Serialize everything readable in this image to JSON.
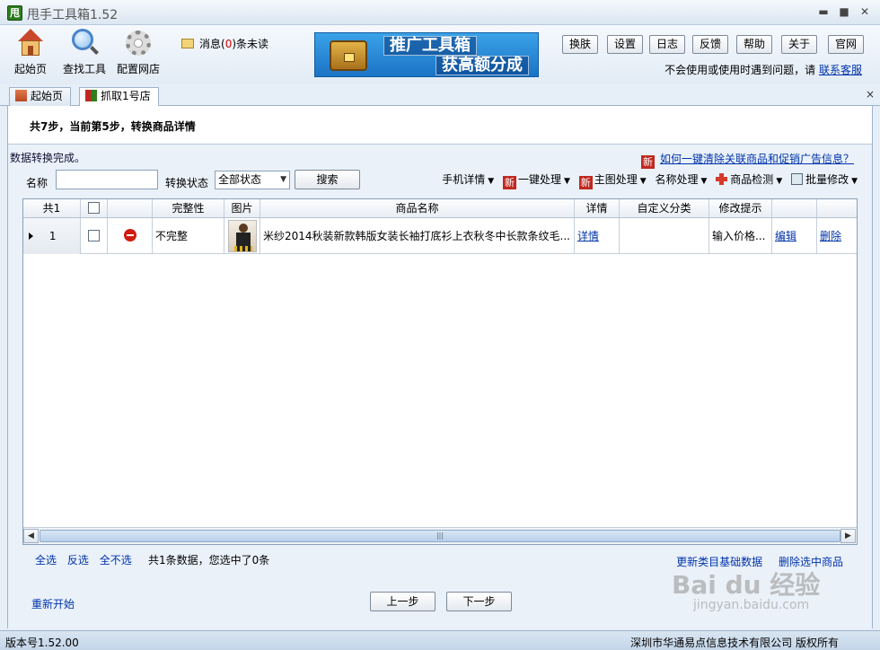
{
  "window": {
    "app_icon_text": "甩",
    "title": "甩手工具箱1.52",
    "minimize": "▬",
    "maximize": "■",
    "close": "✕"
  },
  "toolbar": {
    "tools": [
      {
        "label": "起始页",
        "icon": "house-icon"
      },
      {
        "label": "查找工具",
        "icon": "search-icon"
      },
      {
        "label": "配置网店",
        "icon": "gear-icon"
      }
    ],
    "message": {
      "prefix": "消息(",
      "count": "0",
      "suffix": ")条未读"
    },
    "banner": {
      "line1": "推广工具箱",
      "line2": "获高额分成"
    },
    "buttons": [
      "换肤",
      "设置",
      "日志",
      "反馈",
      "帮助",
      "关于",
      "官网"
    ],
    "help_text": "不会使用或使用时遇到问题，请",
    "help_link": "联系客服"
  },
  "tabs": [
    {
      "label": "起始页",
      "icon": "house-icon",
      "active": false
    },
    {
      "label": "抓取1号店",
      "icon": "store-icon",
      "active": true
    }
  ],
  "tab_close": "×",
  "step_text": "共7步，当前第5步，转换商品详情",
  "status_message": "数据转换完成。",
  "clear_link": {
    "badge": "新",
    "text": "如何一键清除关联商品和促销广告信息？"
  },
  "filter": {
    "name_label": "名称",
    "name_value": "",
    "status_label": "转换状态",
    "status_selected": "全部状态",
    "search_button": "搜索"
  },
  "actions": [
    {
      "label": "手机详情",
      "badge": ""
    },
    {
      "label": "一键处理",
      "badge": "新"
    },
    {
      "label": "主图处理",
      "badge": "新"
    },
    {
      "label": "名称处理",
      "badge": ""
    },
    {
      "label": "商品检测",
      "badge": ""
    },
    {
      "label": "批量修改",
      "badge": ""
    }
  ],
  "grid": {
    "count_header": "共1",
    "columns": [
      "完整性",
      "图片",
      "商品名称",
      "详情",
      "自定义分类",
      "修改提示"
    ],
    "rows": [
      {
        "index": "1",
        "completeness": "不完整",
        "name": "米纱2014秋装新款韩版女装长袖打底衫上衣秋冬中长款条纹毛...",
        "detail_link": "详情",
        "category": "",
        "hint": "输入价格...",
        "edit_link": "编辑",
        "delete_link": "删除"
      }
    ],
    "scroll_grip": "|||"
  },
  "bottom": {
    "select_all": "全选",
    "invert": "反选",
    "select_none": "全不选",
    "selection_info": "共1条数据，您选中了0条",
    "update_category": "更新类目基础数据",
    "delete_selected": "删除选中商品",
    "restart": "重新开始",
    "prev": "上一步",
    "next": "下一步"
  },
  "watermark": {
    "main": "Bai du 经验",
    "sub": "jingyan.baidu.com"
  },
  "statusbar": {
    "version": "版本号1.52.00",
    "copyright": "深圳市华通易点信息技术有限公司 版权所有"
  },
  "colors": {
    "accent_blue": "#1b73c6",
    "message_count": "#d00000",
    "new_badge": "#c0281f",
    "stop_icon": "#d01b10"
  }
}
